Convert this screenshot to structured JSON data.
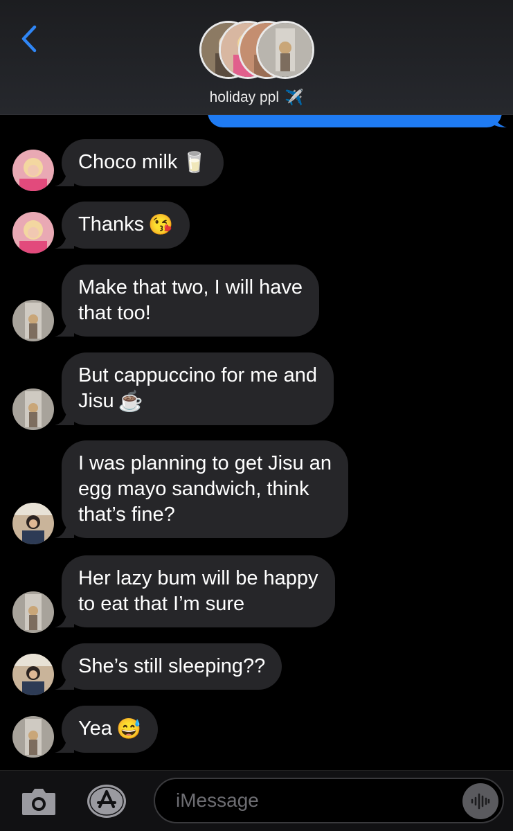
{
  "header": {
    "back_icon": "chevron-left-icon",
    "title": "holiday ppl",
    "title_emoji": "✈️",
    "accent": "#1f7bf3"
  },
  "messages": [
    {
      "sender_avatar": "avatar-blonde",
      "text": "Choco milk",
      "emoji": "🥛"
    },
    {
      "sender_avatar": "avatar-blonde",
      "text": "Thanks",
      "emoji": "😘"
    },
    {
      "sender_avatar": "avatar-hallway",
      "text": "Make that two, I will have\nthat too!",
      "emoji": ""
    },
    {
      "sender_avatar": "avatar-hallway",
      "text": "But cappuccino for me and\nJisu",
      "emoji": "☕"
    },
    {
      "sender_avatar": "avatar-dark-hair",
      "text": "I was planning to get Jisu an\negg mayo sandwich, think\nthat’s fine?",
      "emoji": ""
    },
    {
      "sender_avatar": "avatar-hallway",
      "text": "Her lazy bum will be happy\nto eat that I’m sure",
      "emoji": ""
    },
    {
      "sender_avatar": "avatar-dark-hair",
      "text": "She’s still sleeping??",
      "emoji": ""
    },
    {
      "sender_avatar": "avatar-hallway",
      "text": "Yea",
      "emoji": "😅"
    }
  ],
  "input_bar": {
    "camera_icon": "camera-icon",
    "apps_icon": "app-store-icon",
    "placeholder": "iMessage",
    "audio_icon": "audio-waveform-icon"
  },
  "colors": {
    "background": "#000000",
    "received_bubble": "#262629",
    "sent_bubble": "#1f7bf3"
  }
}
